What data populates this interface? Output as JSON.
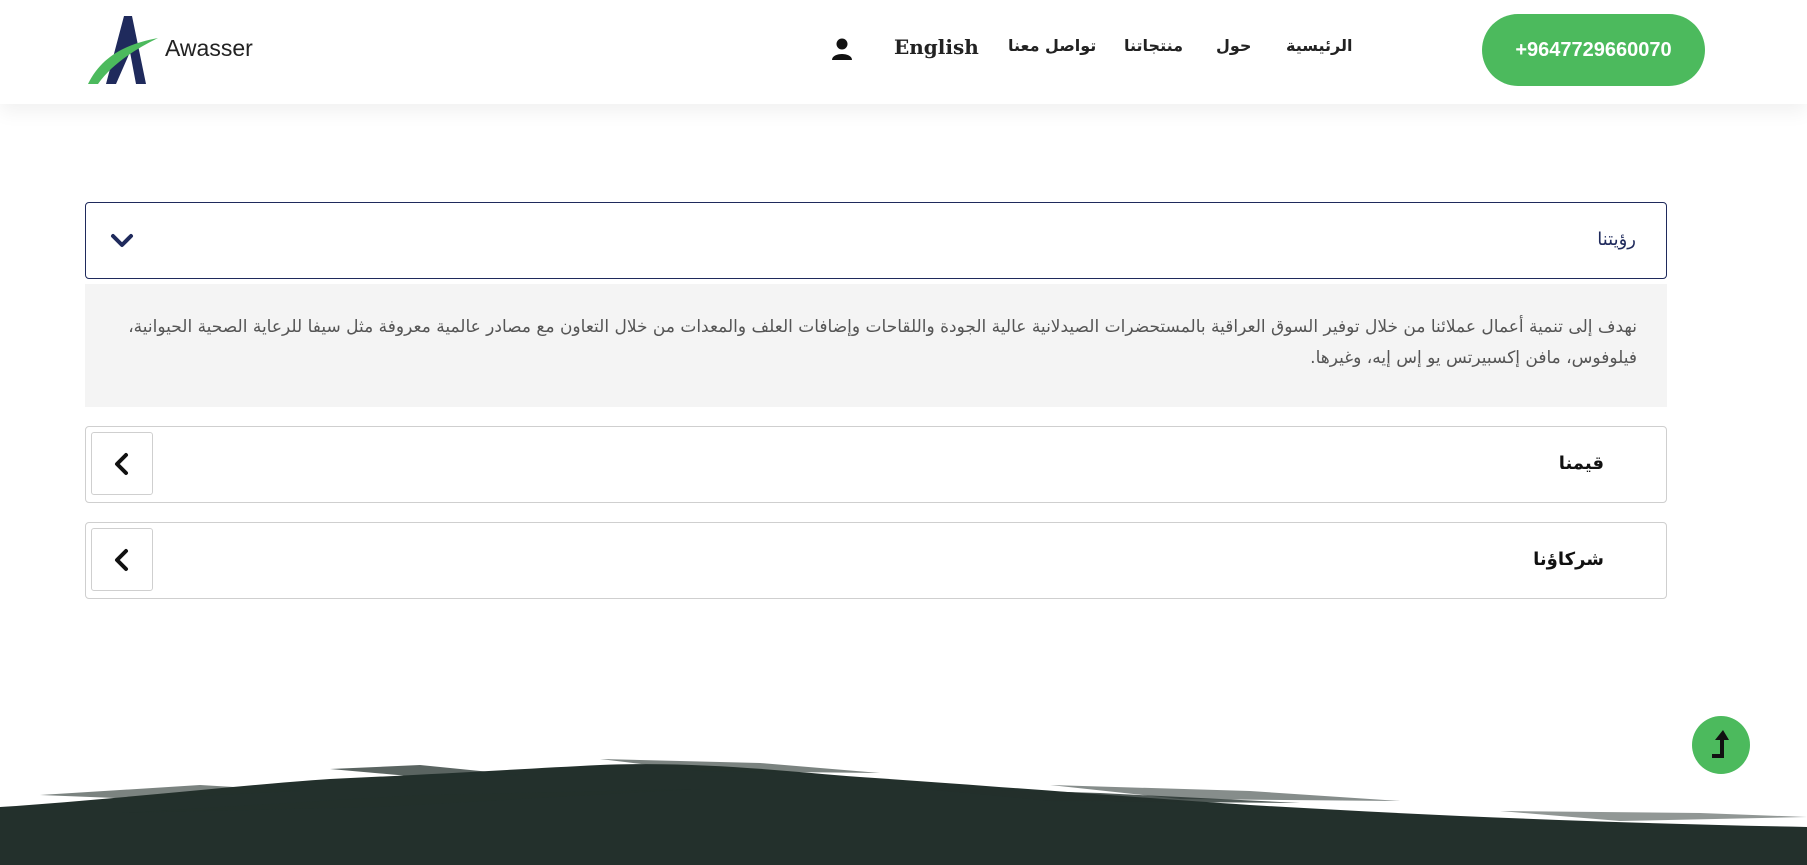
{
  "brand": {
    "name": "Awasser",
    "logo_icon": "awasser-a-logo",
    "colors": {
      "navy": "#1f2a5c",
      "green": "#4cba5d"
    }
  },
  "nav": {
    "home": "الرئيسية",
    "about": "حول",
    "products": "منتجاتنا",
    "contact": "تواصل معنا",
    "language": "English",
    "user_icon": "user-icon"
  },
  "phone": {
    "label": "+9647729660070"
  },
  "accordion": {
    "vision": {
      "title": "رؤيتنا",
      "body": "نهدف إلى تنمية أعمال عملائنا من خلال توفير السوق العراقية بالمستحضرات الصيدلانية عالية الجودة واللقاحات وإضافات العلف والمعدات من خلال التعاون مع مصادر عالمية معروفة مثل سيفا للرعاية الصحية الحيوانية، فيلوفوس، مافن إكسبيرتس يو إس إيه، وغيرها.",
      "expanded": true
    },
    "values": {
      "title": "قيمنا",
      "expanded": false
    },
    "partners": {
      "title": "شركاؤنا",
      "expanded": false
    }
  },
  "back_to_top": {
    "icon": "arrow-up-icon"
  },
  "footer": {
    "decoration": "dark-brush-stroke",
    "color": "#23302c"
  }
}
